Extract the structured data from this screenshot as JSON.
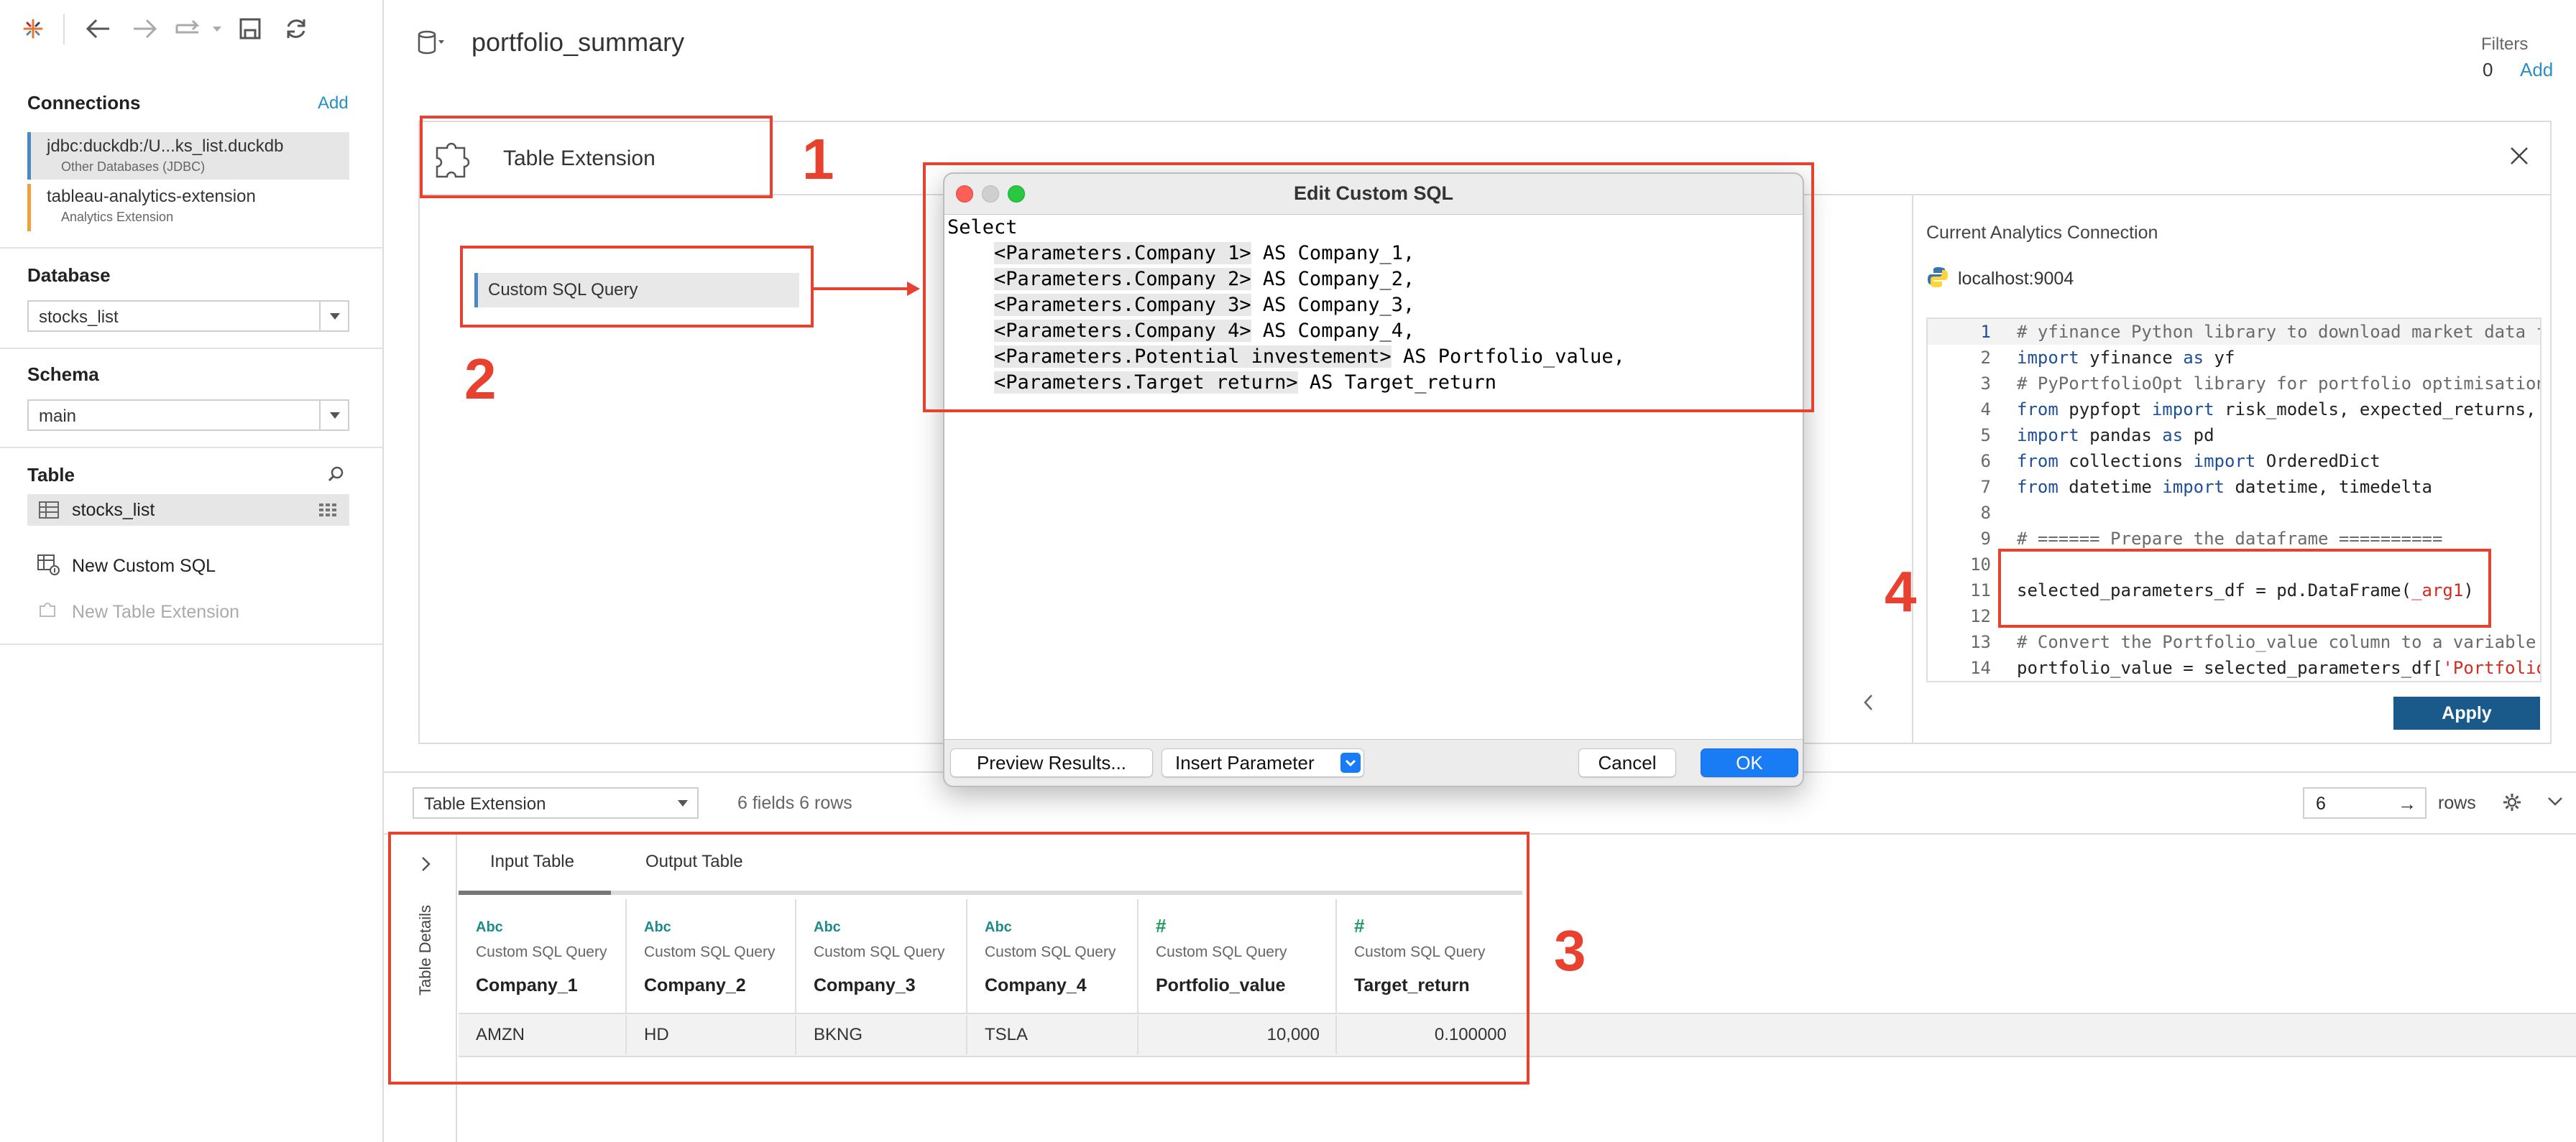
{
  "toolbar": {
    "icons": [
      "tableau-logo-icon",
      "back-icon",
      "forward-icon",
      "redo-icon",
      "save-icon",
      "refresh-icon"
    ]
  },
  "connections": {
    "heading": "Connections",
    "add": "Add",
    "items": [
      {
        "name": "jdbc:duckdb:/U...ks_list.duckdb",
        "type": "Other Databases (JDBC)"
      },
      {
        "name": "tableau-analytics-extension",
        "type": "Analytics Extension"
      }
    ]
  },
  "database": {
    "heading": "Database",
    "value": "stocks_list"
  },
  "schema": {
    "heading": "Schema",
    "value": "main"
  },
  "table": {
    "heading": "Table",
    "item": "stocks_list",
    "new_sql": "New Custom SQL",
    "new_ext": "New Table Extension"
  },
  "header": {
    "title": "portfolio_summary",
    "filters_label": "Filters",
    "filters_count": "0",
    "filters_add": "Add"
  },
  "extension": {
    "title": "Table Extension",
    "query_item": "Custom SQL Query",
    "analytics_label": "Current Analytics Connection",
    "host": "localhost:9004",
    "apply": "Apply"
  },
  "annotations": {
    "n1": "1",
    "n2": "2",
    "n3": "3",
    "n4": "4"
  },
  "code": [
    {
      "n": "1",
      "t": "# yfinance Python library to download market data from Yahoo Finance"
    },
    {
      "n": "2",
      "t": "import yfinance as yf"
    },
    {
      "n": "3",
      "t": "# PyPortfolioOpt library for portfolio optimisation"
    },
    {
      "n": "4",
      "t": "from pypfopt import risk_models, expected_returns, EfficientFrontier"
    },
    {
      "n": "5",
      "t": "import pandas as pd"
    },
    {
      "n": "6",
      "t": "from collections import OrderedDict"
    },
    {
      "n": "7",
      "t": "from datetime import datetime, timedelta"
    },
    {
      "n": "8",
      "t": ""
    },
    {
      "n": "9",
      "t": "# ====== Prepare the dataframe =========="
    },
    {
      "n": "10",
      "t": ""
    },
    {
      "n": "11",
      "t": "selected_parameters_df = pd.DataFrame(_arg1)"
    },
    {
      "n": "12",
      "t": ""
    },
    {
      "n": "13",
      "t": "# Convert the Portfolio_value column to a variable"
    },
    {
      "n": "14",
      "t": "portfolio_value = selected_parameters_df['Portfolio_value']"
    }
  ],
  "dialog": {
    "title": "Edit Custom SQL",
    "sql": [
      "Select",
      "    <Parameters.Company 1> AS Company_1,",
      "    <Parameters.Company 2> AS Company_2,",
      "    <Parameters.Company 3> AS Company_3,",
      "    <Parameters.Company 4> AS Company_4,",
      "    <Parameters.Potential investement> AS Portfolio_value,",
      "    <Parameters.Target return> AS Target_return"
    ],
    "preview": "Preview Results...",
    "insert": "Insert Parameter",
    "cancel": "Cancel",
    "ok": "OK"
  },
  "results": {
    "selector": "Table Extension",
    "summary": "6 fields 6 rows",
    "rows_value": "6",
    "rows_label": "rows",
    "details_label": "Table Details",
    "tabs": [
      "Input Table",
      "Output Table"
    ],
    "columns": [
      {
        "type": "Abc",
        "source": "Custom SQL Query",
        "name": "Company_1"
      },
      {
        "type": "Abc",
        "source": "Custom SQL Query",
        "name": "Company_2"
      },
      {
        "type": "Abc",
        "source": "Custom SQL Query",
        "name": "Company_3"
      },
      {
        "type": "Abc",
        "source": "Custom SQL Query",
        "name": "Company_4"
      },
      {
        "type": "#",
        "source": "Custom SQL Query",
        "name": "Portfolio_value"
      },
      {
        "type": "#",
        "source": "Custom SQL Query",
        "name": "Target_return"
      }
    ],
    "row": [
      "AMZN",
      "HD",
      "BKNG",
      "TSLA",
      "10,000",
      "0.100000"
    ]
  },
  "colors": {
    "accent": "#1f77b4",
    "annotation": "#e8412f",
    "apply": "#1a5a8a",
    "ok": "#1a7cf5"
  }
}
